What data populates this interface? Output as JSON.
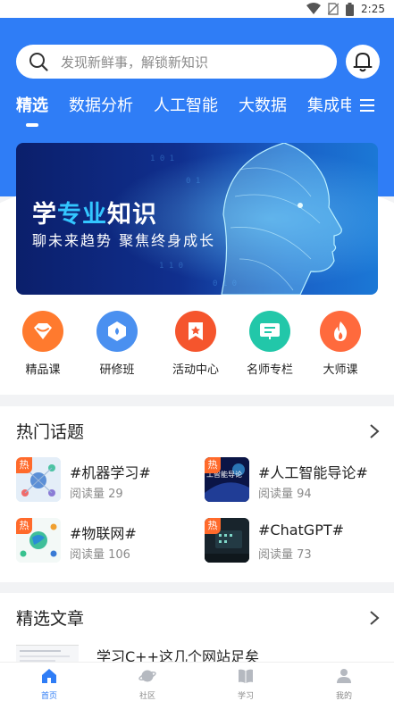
{
  "status_bar": {
    "time": "2:25"
  },
  "search": {
    "placeholder": "发现新鲜事，解锁新知识"
  },
  "tabs": [
    {
      "label": "精选"
    },
    {
      "label": "数据分析"
    },
    {
      "label": "人工智能"
    },
    {
      "label": "大数据"
    },
    {
      "label": "集成电"
    }
  ],
  "banner": {
    "title_prefix": "学",
    "title_highlight": "专业",
    "title_suffix": "知识",
    "subtitle": "聊未来趋势  聚焦终身成长"
  },
  "quick_entries": [
    {
      "label": "精品课",
      "icon": "diamond-icon",
      "color": "#ff7a2e"
    },
    {
      "label": "研修班",
      "icon": "badge-icon",
      "color": "#4a90f0"
    },
    {
      "label": "活动中心",
      "icon": "bookmark-star-icon",
      "color": "#f5552d"
    },
    {
      "label": "名师专栏",
      "icon": "presentation-icon",
      "color": "#22c7a9"
    },
    {
      "label": "大师课",
      "icon": "flame-icon",
      "color": "#ff6a3d"
    }
  ],
  "hot_topics": {
    "title": "热门话题",
    "hot_badge": "热",
    "items": [
      {
        "title": "#机器学习#",
        "reads": "阅读量 29"
      },
      {
        "title": "#人工智能导论#",
        "reads": "阅读量 94",
        "thumb_text": "工智能导论"
      },
      {
        "title": "#物联网#",
        "reads": "阅读量 106"
      },
      {
        "title": "#ChatGPT#",
        "reads": "阅读量 73"
      }
    ]
  },
  "articles": {
    "title": "精选文章",
    "items": [
      {
        "title": "学习C++这几个网站足矣"
      }
    ]
  },
  "bottom_nav": [
    {
      "label": "首页",
      "icon": "home-icon",
      "active": true
    },
    {
      "label": "社区",
      "icon": "planet-icon",
      "active": false
    },
    {
      "label": "学习",
      "icon": "book-icon",
      "active": false
    },
    {
      "label": "我的",
      "icon": "user-icon",
      "active": false
    }
  ],
  "colors": {
    "primary": "#2f7df6",
    "hot": "#ff6a2b"
  }
}
